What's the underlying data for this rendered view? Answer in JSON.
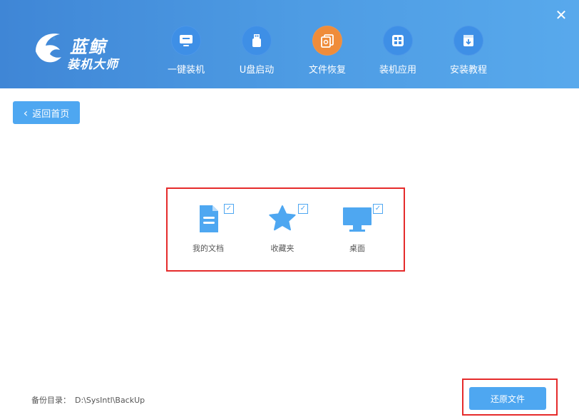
{
  "window": {
    "close_glyph": "✕"
  },
  "logo": {
    "title": "蓝鲸",
    "subtitle": "装机大师",
    "icon": "dolphin-logo-icon"
  },
  "nav": {
    "items": [
      {
        "label": "一键装机",
        "icon": "monitor-icon",
        "active": false
      },
      {
        "label": "U盘启动",
        "icon": "usb-icon",
        "active": false
      },
      {
        "label": "文件恢复",
        "icon": "file-restore-icon",
        "active": true
      },
      {
        "label": "装机应用",
        "icon": "apps-grid-icon",
        "active": false
      },
      {
        "label": "安装教程",
        "icon": "tutorial-icon",
        "active": false
      }
    ]
  },
  "back": {
    "label": "返回首页"
  },
  "folders": [
    {
      "label": "我的文档",
      "icon": "document-icon",
      "checked": true
    },
    {
      "label": "收藏夹",
      "icon": "star-icon",
      "checked": true
    },
    {
      "label": "桌面",
      "icon": "desktop-monitor-icon",
      "checked": true
    }
  ],
  "backup": {
    "label": "备份目录：",
    "path": "D:\\SysIntl\\BackUp"
  },
  "restore": {
    "label": "还原文件"
  },
  "colors": {
    "header_start": "#3f86d6",
    "header_end": "#58a9ec",
    "accent": "#4ea7f1",
    "active_nav": "#ef8c3a",
    "highlight": "#e52b2b"
  }
}
